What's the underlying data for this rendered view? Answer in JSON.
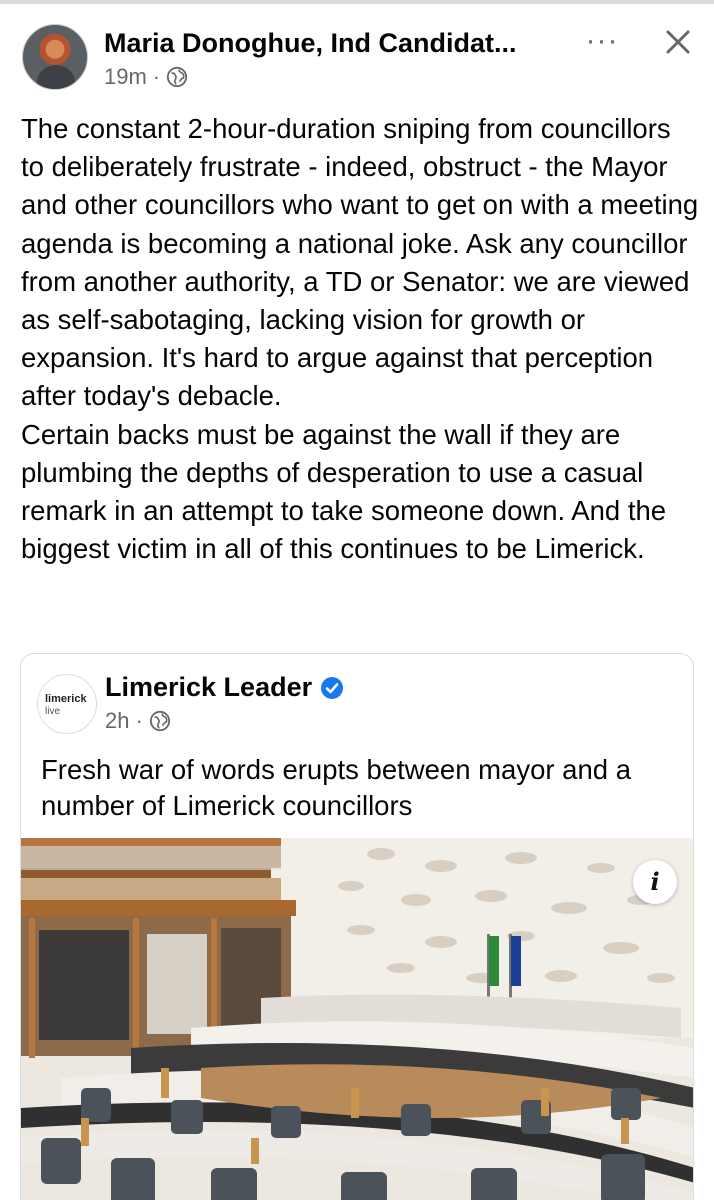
{
  "post": {
    "author": "Maria Donoghue, Ind Candidat...",
    "time": "19m",
    "separator": "·",
    "privacy_icon": "globe-icon",
    "more_icon": "more-options-icon",
    "more_label": "···",
    "close_icon": "close-icon",
    "text": "The constant 2-hour-duration sniping from councillors to deliberately frustrate - indeed, obstruct - the Mayor and other councillors who want to get on with a meeting agenda is becoming a national joke. Ask any councillor from another authority, a TD or Senator: we are viewed as self-sabotaging, lacking vision for growth or expansion. It's hard to argue against that perception after today's debacle.\nCertain backs must be against the wall if they are plumbing the depths of desperation to use a casual remark in an attempt to take someone down. And the biggest victim in all of this continues to be Limerick."
  },
  "shared": {
    "logo_line1": "limerick",
    "logo_line2": "live",
    "page_name": "Limerick Leader",
    "verified_icon": "verified-badge-icon",
    "time": "2h",
    "separator": "·",
    "privacy_icon": "globe-icon",
    "text": "Fresh war of words erupts between mayor and a number of Limerick councillors",
    "info_label": "i",
    "info_icon": "info-icon"
  },
  "colors": {
    "text": "#050505",
    "secondary": "#65676b",
    "verified": "#1877f2",
    "border": "#dadde1"
  }
}
